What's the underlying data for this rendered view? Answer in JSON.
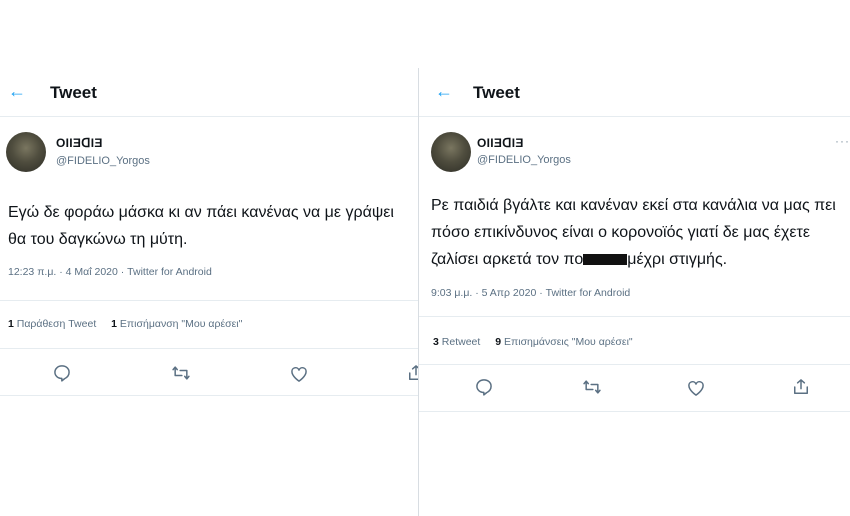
{
  "tweet1": {
    "header_title": "Tweet",
    "display_name": "ΟΙΙƎꓷIƎ",
    "handle": "@FIDELIO_Yorgos",
    "text": "Εγώ δε φοράω μάσκα κι αν πάει κανένας να με γράψει θα του δαγκώνω τη μύτη.",
    "timestamp": "12:23 π.μ. · 4 Μαΐ 2020 · Twitter for Android",
    "stat1_count": "1",
    "stat1_label": "Παράθεση Tweet",
    "stat2_count": "1",
    "stat2_label": "Επισήμανση \"Μου αρέσει\""
  },
  "tweet2": {
    "header_title": "Tweet",
    "display_name": "ΟΙΙƎꓷIƎ",
    "handle": "@FIDELIO_Yorgos",
    "text_before_redaction": "Ρε παιδιά βγάλτε και κανέναν εκεί στα κανάλια να μας πει πόσο επικίνδυνος είναι ο κορονοϊός γιατί δε μας έχετε ζαλίσει αρκετά τον πο",
    "text_after_redaction": "μέχρι στιγμής.",
    "timestamp": "9:03 μ.μ. · 5 Απρ 2020 · Twitter for Android",
    "stat1_count": "3",
    "stat1_label": "Retweet",
    "stat2_count": "9",
    "stat2_label": "Επισημάνσεις \"Μου αρέσει\"",
    "more_glyph": "···"
  },
  "icons": {
    "back": "←",
    "accent": "#1da1f2",
    "icon_gray": "#5b7083"
  }
}
